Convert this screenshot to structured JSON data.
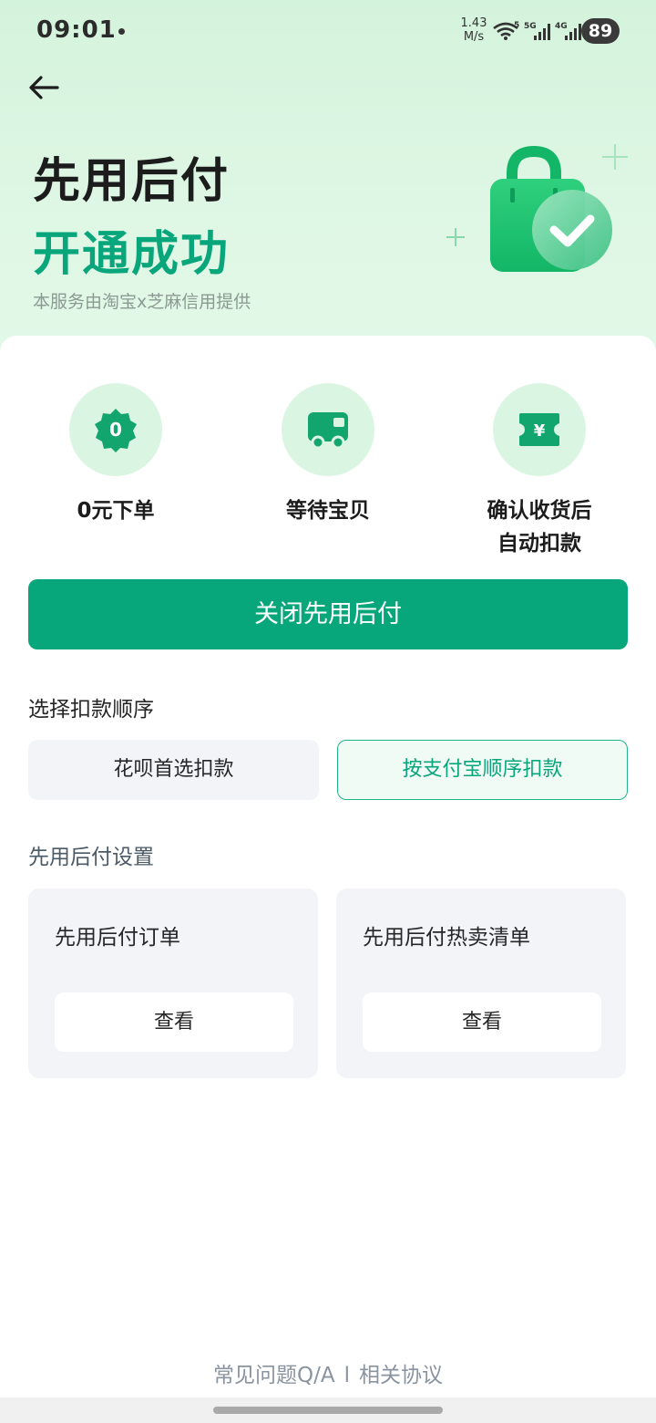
{
  "status_bar": {
    "time": "09:01",
    "net_speed_value": "1.43",
    "net_speed_unit": "M/s",
    "wifi_badge": "5",
    "sim1_label": "5G",
    "sim2_label": "4G",
    "battery": "89"
  },
  "header": {
    "back_icon": "arrow-left-icon",
    "title": "先用后付",
    "subtitle": "开通成功",
    "note": "本服务由淘宝x芝麻信用提供",
    "illustration": "shopping-bag-check-icon"
  },
  "features": [
    {
      "icon": "zero-badge-icon",
      "badge_text": "0",
      "label_lines": [
        "0元下单"
      ]
    },
    {
      "icon": "truck-icon",
      "label_lines": [
        "等待宝贝"
      ]
    },
    {
      "icon": "yuan-ticket-icon",
      "badge_text": "¥",
      "label_lines": [
        "确认收货后",
        "自动扣款"
      ]
    }
  ],
  "primary_action": {
    "label": "关闭先用后付"
  },
  "payment_order": {
    "section_label": "选择扣款顺序",
    "options": [
      {
        "label": "花呗首选扣款",
        "selected": false
      },
      {
        "label": "按支付宝顺序扣款",
        "selected": true
      }
    ]
  },
  "settings": {
    "section_label": "先用后付设置",
    "cards": [
      {
        "title": "先用后付订单",
        "button": "查看"
      },
      {
        "title": "先用后付热卖清单",
        "button": "查看"
      }
    ]
  },
  "footer": {
    "faq": "常见问题Q/A",
    "separator": "l",
    "agreement": "相关协议"
  },
  "colors": {
    "brand_green": "#08a67b",
    "hero_background": "#d4f3dc",
    "icon_circle": "#dbf5e3"
  }
}
